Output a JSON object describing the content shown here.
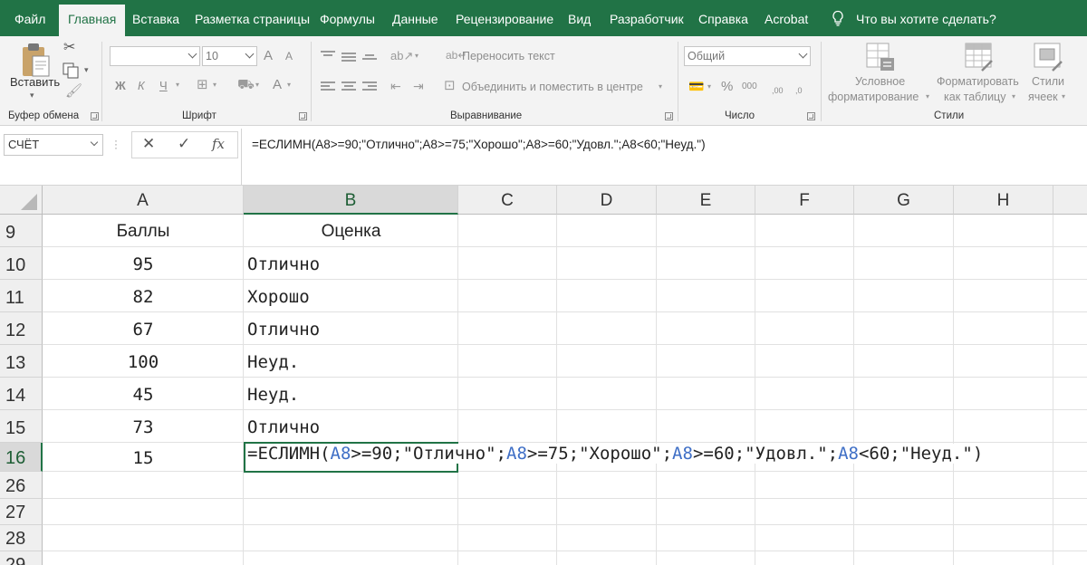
{
  "menu_tabs": [
    "Файл",
    "Главная",
    "Вставка",
    "Разметка страницы",
    "Формулы",
    "Данные",
    "Рецензирование",
    "Вид",
    "Разработчик",
    "Справка",
    "Acrobat"
  ],
  "active_tab": "Главная",
  "tell_me": "Что вы хотите сделать?",
  "ribbon": {
    "clipboard": {
      "paste_label": "Вставить",
      "group_label": "Буфер обмена"
    },
    "font": {
      "font_name": "",
      "font_size": "10",
      "bold": "Ж",
      "italic": "К",
      "underline": "Ч",
      "grow": "A",
      "shrink": "A",
      "font_color": "A",
      "group_label": "Шрифт"
    },
    "alignment": {
      "wrap_text": "Переносить текст",
      "merge_center": "Объединить и поместить в центре",
      "group_label": "Выравнивание"
    },
    "number": {
      "format": "Общий",
      "percent": "%",
      "thousands": "000",
      "inc_decimal": ",00",
      "dec_decimal": ",0",
      "group_label": "Число"
    },
    "styles": {
      "conditional_line1": "Условное",
      "conditional_line2": "форматирование",
      "table_line1": "Форматировать",
      "table_line2": "как таблицу",
      "cell_line1": "Стили",
      "cell_line2": "ячеек",
      "group_label": "Стили"
    }
  },
  "formula_bar": {
    "name_box": "СЧЁТ",
    "fx_label": "fx",
    "formula": "=ЕСЛИМН(A8>=90;\"Отлично\";A8>=75;\"Хорошо\";A8>=60;\"Удовл.\";A8<60;\"Неуд.\")"
  },
  "columns": [
    "A",
    "B",
    "C",
    "D",
    "E",
    "F",
    "G",
    "H"
  ],
  "rows": [
    {
      "num": "9",
      "a": "Баллы",
      "b": "Оценка"
    },
    {
      "num": "10",
      "a": "95",
      "b": "Отлично"
    },
    {
      "num": "11",
      "a": "82",
      "b": "Хорошо"
    },
    {
      "num": "12",
      "a": "67",
      "b": "Отлично"
    },
    {
      "num": "13",
      "a": "100",
      "b": "Неуд."
    },
    {
      "num": "14",
      "a": "45",
      "b": "Неуд."
    },
    {
      "num": "15",
      "a": "73",
      "b": "Отлично"
    },
    {
      "num": "16",
      "a": "15",
      "b": ""
    },
    {
      "num": "26",
      "a": "",
      "b": ""
    },
    {
      "num": "27",
      "a": "",
      "b": ""
    },
    {
      "num": "28",
      "a": "",
      "b": ""
    },
    {
      "num": "29",
      "a": "",
      "b": ""
    }
  ],
  "editing": {
    "parts": [
      "=ЕСЛИМН(",
      "A8",
      ">=90;\"Отлично\";",
      "A8",
      ">=75;\"Хорошо\";",
      "A8",
      ">=60;\"Удовл.\";",
      "A8",
      "<60;\"Неуд.\")"
    ]
  },
  "colors": {
    "accent": "#217346",
    "reference": "#3f6fc6"
  }
}
